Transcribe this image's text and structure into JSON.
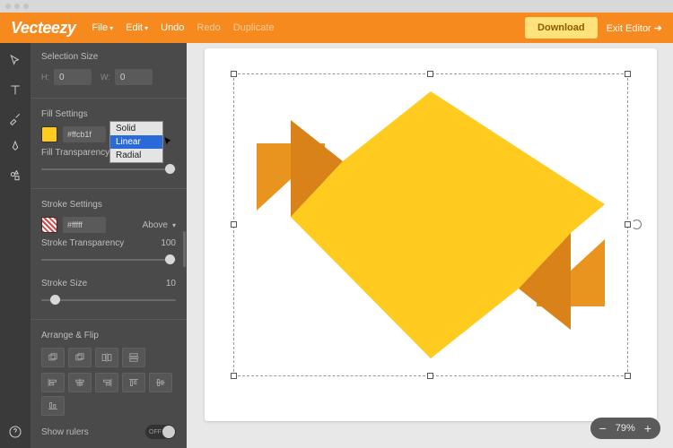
{
  "brand": "Vecteezy",
  "menu": {
    "file": "File",
    "edit": "Edit",
    "undo": "Undo",
    "redo": "Redo",
    "duplicate": "Duplicate"
  },
  "actions": {
    "download": "Download",
    "exit": "Exit Editor ➔"
  },
  "selection": {
    "label": "Selection Size",
    "h_label": "H:",
    "w_label": "W:",
    "h": "0",
    "w": "0"
  },
  "fill": {
    "label": "Fill Settings",
    "hex": "#ffcb1f",
    "dropdown": {
      "options": [
        "Solid",
        "Linear",
        "Radial"
      ],
      "selected": "Linear"
    },
    "transparency_label": "Fill Transparency",
    "transparency": ""
  },
  "stroke": {
    "label": "Stroke Settings",
    "hex": "#fffff",
    "position": "Above",
    "transparency_label": "Stroke Transparency",
    "transparency": "100",
    "size_label": "Stroke Size",
    "size": "10"
  },
  "arrange": {
    "label": "Arrange & Flip"
  },
  "rulers": {
    "label": "Show rulers",
    "state": "OFF"
  },
  "zoom": {
    "value": "79%"
  },
  "colors": {
    "brand": "#f68a1e",
    "download": "#ffe27a",
    "swatch": "#ffcb1f"
  }
}
